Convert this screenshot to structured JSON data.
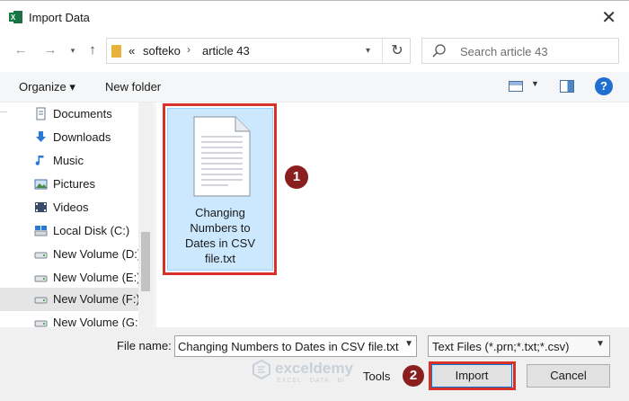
{
  "window": {
    "title": "Import Data",
    "app_icon": "excel-icon",
    "close_glyph": "✕"
  },
  "nav": {
    "back_glyph": "←",
    "forward_glyph": "→",
    "up_glyph": "↑",
    "breadcrumb_prefix": "«",
    "breadcrumb": [
      "softeko",
      "article 43"
    ],
    "breadcrumb_sep": "›",
    "refresh_glyph": "↻",
    "search_placeholder": "Search article 43"
  },
  "toolbar": {
    "organize_label": "Organize ▾",
    "new_folder_label": "New folder",
    "help_glyph": "?"
  },
  "sidebar": {
    "items": [
      {
        "label": "Documents",
        "icon": "documents-icon"
      },
      {
        "label": "Downloads",
        "icon": "downloads-icon"
      },
      {
        "label": "Music",
        "icon": "music-icon"
      },
      {
        "label": "Pictures",
        "icon": "pictures-icon"
      },
      {
        "label": "Videos",
        "icon": "videos-icon"
      },
      {
        "label": "Local Disk (C:)",
        "icon": "drive-icon"
      },
      {
        "label": "New Volume (D:)",
        "icon": "drive-icon"
      },
      {
        "label": "New Volume (E:)",
        "icon": "drive-icon"
      },
      {
        "label": "New Volume (F:)",
        "icon": "drive-icon",
        "state": "hover"
      },
      {
        "label": "New Volume (G:)",
        "icon": "drive-icon"
      }
    ]
  },
  "files": [
    {
      "name": "Changing Numbers to Dates in CSV file.txt",
      "name_lines": [
        "Changing",
        "Numbers to",
        "Dates in CSV",
        "file.txt"
      ],
      "icon": "text-document-icon",
      "selected": true
    }
  ],
  "annotations": {
    "step1": "1",
    "step2": "2",
    "highlight_color": "#d8312a",
    "badge_color": "#8b1f1f"
  },
  "footer": {
    "file_name_label": "File name:",
    "file_name_value": "Changing Numbers to Dates in CSV file.txt",
    "file_type_value": "Text Files (*.prn;*.txt;*.csv)",
    "tools_label": "Tools",
    "import_label": "Import",
    "cancel_label": "Cancel"
  },
  "watermark": {
    "name": "exceldemy",
    "tagline": "EXCEL · DATA · BI"
  }
}
